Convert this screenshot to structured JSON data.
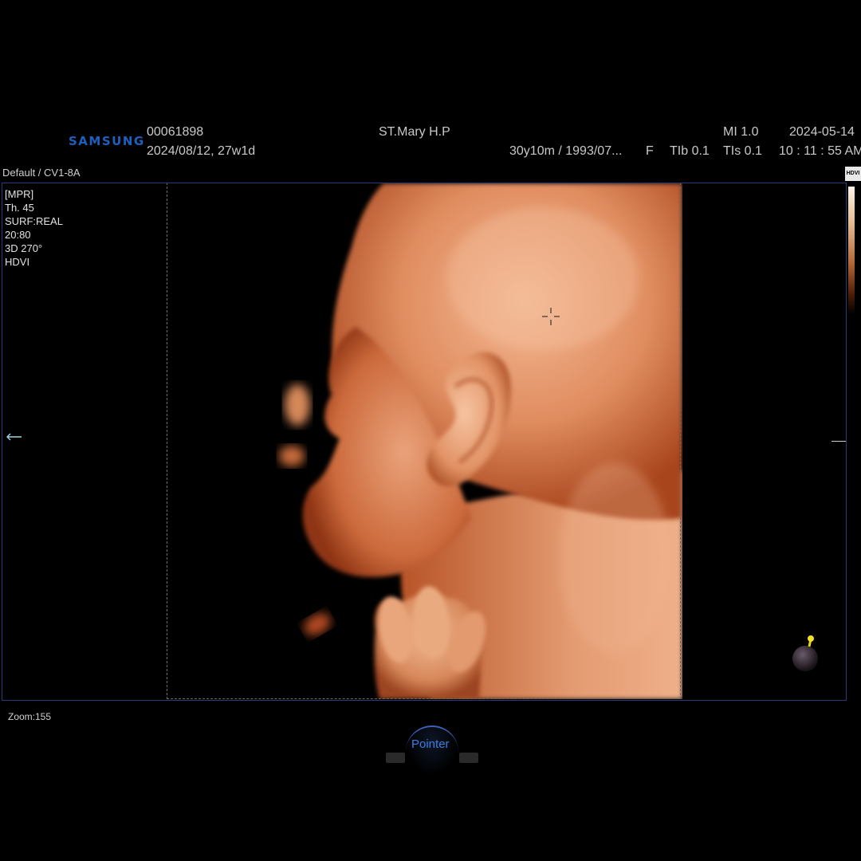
{
  "header": {
    "logo": "SAMSUNG",
    "patient_id": "00061898",
    "exam_date": "2024/08/12, 27w1d",
    "hospital": "ST.Mary H.P",
    "patient_info": "30y10m / 1993/07...",
    "sex": "F",
    "tib": "TIb 0.1",
    "mi": "MI  1.0",
    "tis": "TIs 0.1",
    "date": "2024-05-14",
    "time": "10 : 11 : 55 AM"
  },
  "preset": "Default / CV1-8A",
  "params": [
    "[MPR]",
    "Th. 45",
    "SURF:REAL",
    "20:80",
    "3D 270°",
    "HDVI"
  ],
  "colorbar_label": "HDVI",
  "zoom": "Zoom:155",
  "control": {
    "pointer_label": "Pointer"
  },
  "colors": {
    "accent": "#3f7de0",
    "logo": "#1f5fbf",
    "frame": "#2a3a7a",
    "skin_light": "#f0b08a",
    "skin_mid": "#d47445",
    "skin_dark": "#7a2a10"
  }
}
